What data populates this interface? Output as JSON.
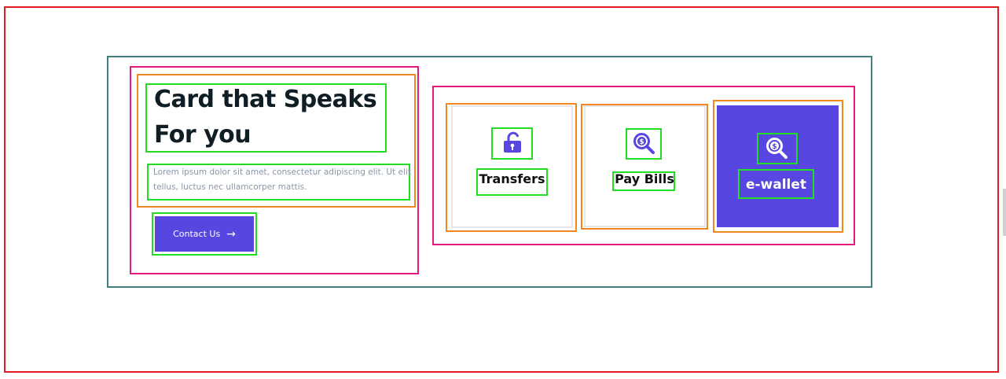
{
  "hero": {
    "heading_line1": "Card that Speaks",
    "heading_line2": "For you",
    "description": "Lorem ipsum dolor sit amet, consectetur adipiscing elit. Ut elit tellus, luctus nec ullamcorper mattis.",
    "cta_label": "Contact Us",
    "cta_arrow": "→"
  },
  "cards": [
    {
      "label": "Transfers",
      "icon": "unlock-icon",
      "active": false
    },
    {
      "label": "Pay Bills",
      "icon": "dollar-search-icon",
      "active": false
    },
    {
      "label": "e-wallet",
      "icon": "dollar-search-icon",
      "active": true
    }
  ],
  "colors": {
    "accent": "#5747e0",
    "heading": "#0f1d24",
    "muted_text": "#8a95a6"
  }
}
